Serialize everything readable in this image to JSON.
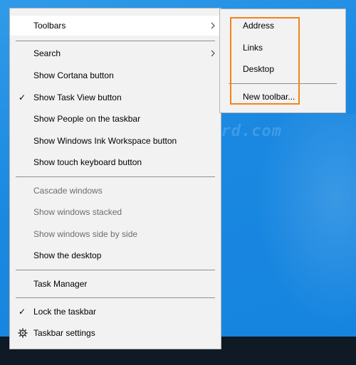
{
  "context_menu": {
    "items": [
      {
        "label": "Toolbars",
        "has_submenu": true,
        "highlighted": true
      },
      {
        "label": "Search",
        "has_submenu": true
      },
      {
        "label": "Show Cortana button"
      },
      {
        "label": "Show Task View button",
        "checked": true
      },
      {
        "label": "Show People on the taskbar"
      },
      {
        "label": "Show Windows Ink Workspace button"
      },
      {
        "label": "Show touch keyboard button"
      },
      {
        "label": "Cascade windows",
        "disabled": true
      },
      {
        "label": "Show windows stacked",
        "disabled": true
      },
      {
        "label": "Show windows side by side",
        "disabled": true
      },
      {
        "label": "Show the desktop"
      },
      {
        "label": "Task Manager"
      },
      {
        "label": "Lock the taskbar",
        "checked": true
      },
      {
        "label": "Taskbar settings",
        "icon": "gear-icon"
      }
    ]
  },
  "toolbars_submenu": {
    "items": [
      {
        "label": "Address"
      },
      {
        "label": "Links"
      },
      {
        "label": "Desktop"
      },
      {
        "label": "New toolbar..."
      }
    ]
  },
  "watermark": "top-password.com",
  "colors": {
    "desktop": "#1a88e1",
    "menu_bg": "#f2f2f2",
    "highlight": "#ffffff",
    "highlight_box": "#f0851a",
    "taskbar": "#101a24"
  }
}
